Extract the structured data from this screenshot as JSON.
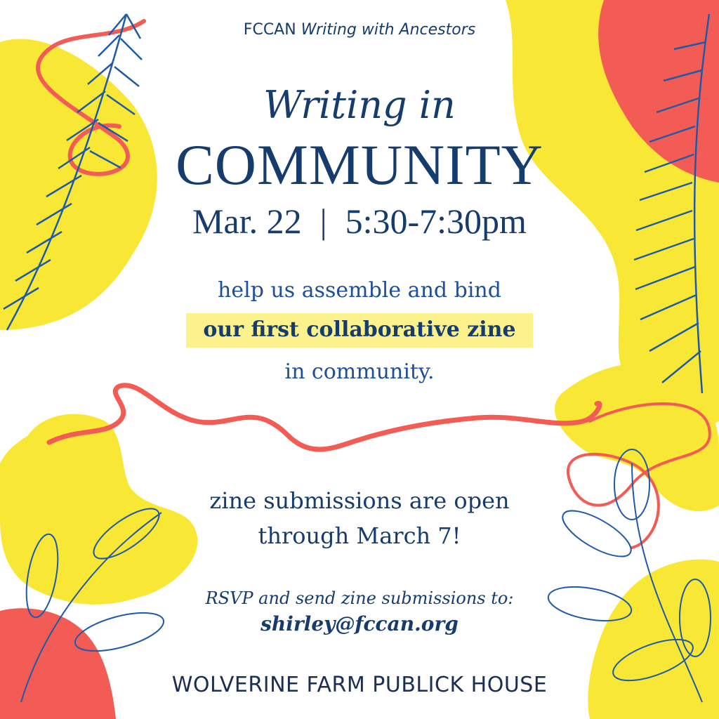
{
  "colors": {
    "yellow": "#f9e735",
    "coral": "#f25c54",
    "navy": "#163c6e",
    "leaf_blue": "#1f5aa8",
    "highlight": "#fbf28e"
  },
  "header": {
    "org": "FCCAN",
    "program": "Writing with Ancestors"
  },
  "title": {
    "line1": "Writing in",
    "line2": "COMMUNITY"
  },
  "event": {
    "date": "Mar. 22",
    "separator": "|",
    "time": "5:30-7:30pm"
  },
  "description": {
    "line1": "help us assemble and bind",
    "highlight": "our first collaborative zine",
    "line3": "in community."
  },
  "submissions": {
    "line1": "zine submissions are open",
    "line2": "through March 7!"
  },
  "rsvp": {
    "prompt": "RSVP and send zine submissions to:",
    "email": "shirley@fccan.org"
  },
  "venue": "WOLVERINE FARM PUBLICK HOUSE",
  "decorations": [
    "fern-leaf-icon",
    "leafy-branch-icon",
    "ribbon-squiggle",
    "color-blob"
  ]
}
